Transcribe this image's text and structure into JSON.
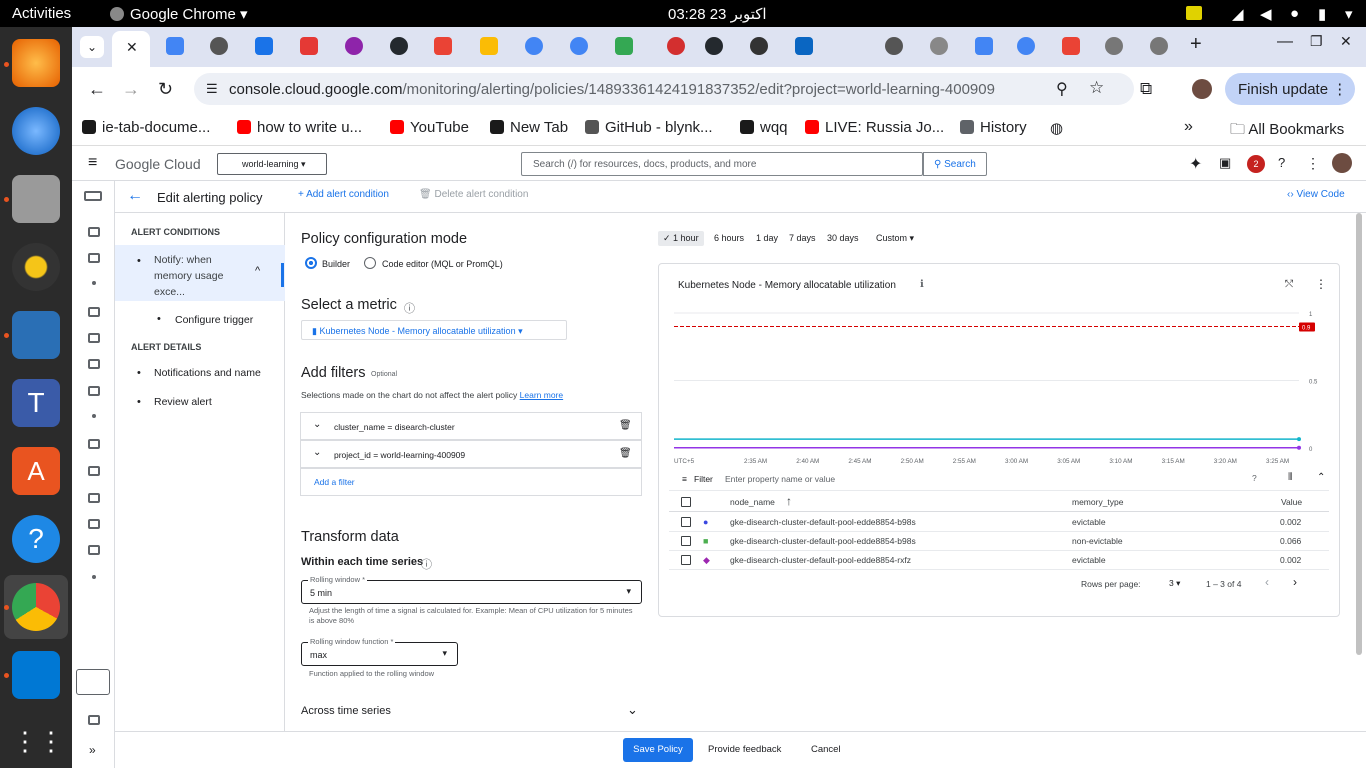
{
  "os": {
    "activities": "Activities",
    "app": "Google Chrome",
    "clock": "03:28  23 اكتوبر"
  },
  "browser": {
    "url_host": "console.cloud.google.com",
    "url_path": "/monitoring/alerting/policies/14893361424191837352/edit?project=world-learning-400909",
    "finish_update": "Finish update",
    "bookmarks": [
      {
        "label": "ie-tab-docume...",
        "color": "#1a1a1a"
      },
      {
        "label": "how to write u...",
        "color": "#ff0000"
      },
      {
        "label": "YouTube",
        "color": "#ff0000"
      },
      {
        "label": "New Tab",
        "color": "#1a1a1a"
      },
      {
        "label": "GitHub - blynk...",
        "color": "#555"
      },
      {
        "label": "wqq",
        "color": "#1a1a1a"
      },
      {
        "label": "LIVE: Russia Jo...",
        "color": "#ff0000"
      },
      {
        "label": "History",
        "color": "#5f6368"
      }
    ],
    "all_bookmarks": "All Bookmarks"
  },
  "gc": {
    "brand": "Google Cloud",
    "project": "world-learning",
    "search_placeholder": "Search (/) for resources, docs, products, and more",
    "search_btn": "Search",
    "notif_count": "2"
  },
  "sub": {
    "title": "Edit alerting policy",
    "add_condition": "Add alert condition",
    "delete_condition": "Delete alert condition",
    "view_code": "View Code"
  },
  "nav": {
    "conditions_header": "ALERT CONDITIONS",
    "condition1": "Notify: when memory usage exce...",
    "trigger": "Configure trigger",
    "details_header": "ALERT DETAILS",
    "notif": "Notifications and name",
    "review": "Review alert"
  },
  "config": {
    "mode_title": "Policy configuration mode",
    "builder": "Builder",
    "code_editor": "Code editor (MQL or PromQL)",
    "metric_title": "Select a metric",
    "metric": "Kubernetes Node - Memory allocatable utilization",
    "filters_title": "Add filters",
    "optional": "Optional",
    "filters_note": "Selections made on the chart do not affect the alert policy",
    "learn_more": "Learn more",
    "filter1": "cluster_name = disearch-cluster",
    "filter2": "project_id = world-learning-400909",
    "add_filter": "Add a filter",
    "transform_title": "Transform data",
    "within": "Within each time series",
    "rw_label": "Rolling window *",
    "rw_value": "5 min",
    "rw_help": "Adjust the length of time a signal is calculated for. Example: Mean of CPU utilization for 5 minutes is above 80%",
    "rwf_label": "Rolling window function *",
    "rwf_value": "max",
    "rwf_help": "Function applied to the rolling window",
    "across": "Across time series"
  },
  "time": {
    "options": [
      "1 hour",
      "6 hours",
      "1 day",
      "7 days",
      "30 days",
      "Custom"
    ]
  },
  "chart_data": {
    "type": "line",
    "title": "Kubernetes Node - Memory allocatable utilization",
    "x": [
      "UTC+5",
      "2:35 AM",
      "2:40 AM",
      "2:45 AM",
      "2:50 AM",
      "2:55 AM",
      "3:00 AM",
      "3:05 AM",
      "3:10 AM",
      "3:15 AM",
      "3:20 AM",
      "3:25 AM"
    ],
    "ylim": [
      0,
      1
    ],
    "yticks": [
      "1",
      "0.5",
      "0"
    ],
    "threshold": 0.9,
    "threshold_label": "0.9",
    "series": [
      {
        "values": [
          0.066,
          0.066,
          0.066,
          0.066,
          0.066,
          0.066,
          0.066,
          0.066,
          0.066,
          0.066,
          0.066,
          0.066
        ],
        "color": "#12b5cb"
      },
      {
        "values": [
          0.002,
          0.002,
          0.002,
          0.002,
          0.002,
          0.002,
          0.002,
          0.002,
          0.002,
          0.002,
          0.002,
          0.002
        ],
        "color": "#9334e6"
      }
    ]
  },
  "table": {
    "filter_label": "Filter",
    "filter_placeholder": "Enter property name or value",
    "headers": [
      "node_name",
      "memory_type",
      "Value"
    ],
    "rows": [
      {
        "node": "gke-disearch-cluster-default-pool-edde8854-b98s",
        "type": "evictable",
        "value": "0.002",
        "color": "#3a47e0"
      },
      {
        "node": "gke-disearch-cluster-default-pool-edde8854-b98s",
        "type": "non-evictable",
        "value": "0.066",
        "color": "#4caf50"
      },
      {
        "node": "gke-disearch-cluster-default-pool-edde8854-rxfz",
        "type": "evictable",
        "value": "0.002",
        "color": "#9c27b0"
      }
    ],
    "rows_per_page": "Rows per page:",
    "per_page": "3",
    "range": "1 – 3 of 4"
  },
  "footer": {
    "save": "Save Policy",
    "feedback": "Provide feedback",
    "cancel": "Cancel"
  }
}
